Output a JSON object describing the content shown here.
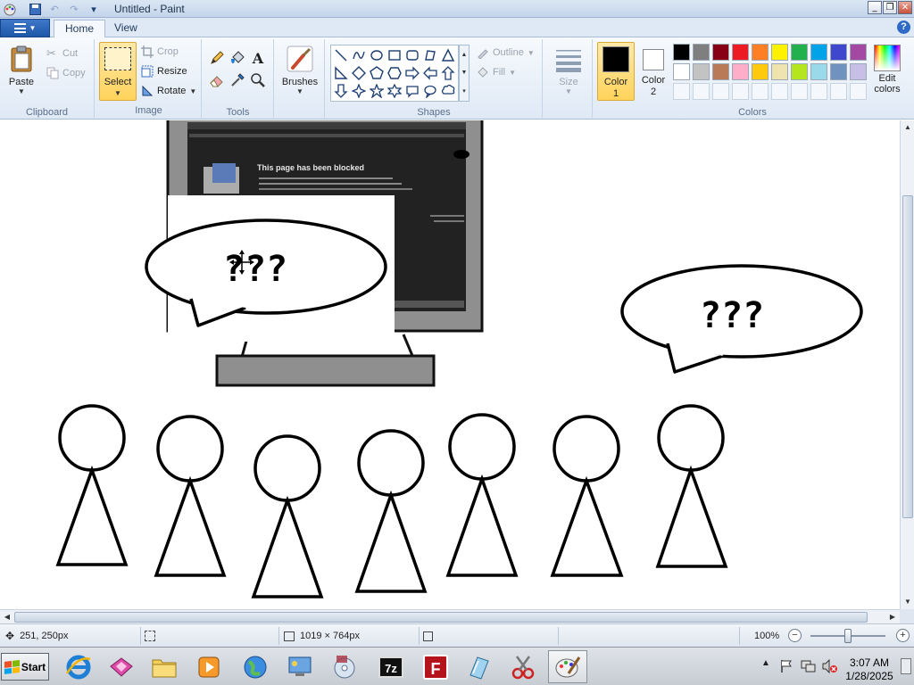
{
  "window": {
    "title": "Untitled - Paint",
    "controls": {
      "minimize": "_",
      "maximize": "❐",
      "close": "✕"
    }
  },
  "ribbon_tabs": {
    "app_menu_icon": "menu-icon",
    "home": "Home",
    "view": "View"
  },
  "ribbon": {
    "clipboard": {
      "group_label": "Clipboard",
      "paste": "Paste",
      "cut": "Cut",
      "copy": "Copy"
    },
    "image": {
      "group_label": "Image",
      "select": "Select",
      "crop": "Crop",
      "resize": "Resize",
      "rotate": "Rotate"
    },
    "tools": {
      "group_label": "Tools",
      "items": [
        "pencil-icon",
        "fill-icon",
        "text-icon",
        "eraser-icon",
        "color-picker-icon",
        "magnifier-icon"
      ]
    },
    "brushes": {
      "label": "Brushes"
    },
    "shapes": {
      "group_label": "Shapes",
      "outline": "Outline",
      "fill": "Fill"
    },
    "size": {
      "label": "Size"
    },
    "colors": {
      "group_label": "Colors",
      "color1": "Color 1",
      "color1_value": "#000000",
      "color2": "Color 2",
      "color2_value": "#ffffff",
      "edit_colors": "Edit colors",
      "palette": [
        "#000000",
        "#7f7f7f",
        "#880015",
        "#ed1c24",
        "#ff7f27",
        "#fff200",
        "#22b14c",
        "#00a2e8",
        "#3f48cc",
        "#a349a4",
        "#ffffff",
        "#c3c3c3",
        "#b97a57",
        "#ffaec9",
        "#ffc90e",
        "#efe4b0",
        "#b5e61d",
        "#99d9ea",
        "#7092be",
        "#c8bfe7"
      ]
    }
  },
  "canvas": {
    "embedded_screenshot_heading": "This page has been blocked",
    "speech_bubble_left": "???",
    "speech_bubble_right": "???"
  },
  "statusbar": {
    "cursor_position": "251, 250px",
    "selection_size": "",
    "image_size": "1019 × 764px",
    "zoom": "100%"
  },
  "taskbar": {
    "start": "Start",
    "time": "3:07 AM",
    "date": "1/28/2025"
  }
}
